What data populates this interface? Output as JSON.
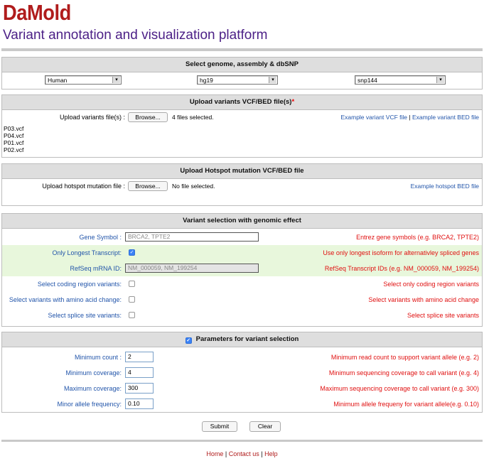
{
  "brand": {
    "logo": "DaMold",
    "subtitle": "Variant annotation and visualization platform"
  },
  "genome_panel": {
    "title": "Select genome, assembly & dbSNP",
    "genome": "Human",
    "assembly": "hg19",
    "dbsnp": "snp144"
  },
  "vcf_panel": {
    "title": "Upload variants VCF/BED file(s)",
    "required_mark": "*",
    "upload_label": "Upload variants file(s) :",
    "browse_label": "Browse...",
    "status": "4 files selected.",
    "example_vcf": "Example variant VCF file",
    "separator": "|",
    "example_bed": "Example variant BED file",
    "files": [
      "P03.vcf",
      "P04.vcf",
      "P01.vcf",
      "P02.vcf"
    ]
  },
  "hotspot_panel": {
    "title": "Upload Hotspot mutation VCF/BED file",
    "upload_label": "Upload hotspot mutation file :",
    "browse_label": "Browse...",
    "status": "No file selected.",
    "example": "Example hotspot BED file"
  },
  "selection_panel": {
    "title": "Variant selection with genomic effect",
    "gene_symbol_label": "Gene Symbol :",
    "gene_symbol_value": "BRCA2, TPTE2",
    "gene_symbol_help": "Entrez gene symbols (e.g. BRCA2, TPTE2)",
    "longest_label": "Only Longest Transcript:",
    "longest_checked": true,
    "longest_help": "Use only longest isoform for alternativley spliced genes",
    "refseq_label": "RefSeq mRNA ID:",
    "refseq_value": "NM_000059, NM_199254",
    "refseq_help": "RefSeq Transcript IDs (e.g. NM_000059, NM_199254)",
    "coding_label": "Select coding region variants:",
    "coding_help": "Select only coding region variants",
    "aa_label": "Select variants with amino acid change:",
    "aa_help": "Select variants with amino acid change",
    "splice_label": "Select splice site variants:",
    "splice_help": "Select splice site variants"
  },
  "params_panel": {
    "title": "Parameters for variant selection",
    "enabled": true,
    "min_count_label": "Minimum count :",
    "min_count_value": "2",
    "min_count_help": "Minimum read count to support variant allele (e.g. 2)",
    "min_cov_label": "Minimum coverage:",
    "min_cov_value": "4",
    "min_cov_help": "Minimum sequencing coverage to call variant (e.g. 4)",
    "max_cov_label": "Maximum coverage:",
    "max_cov_value": "300",
    "max_cov_help": "Maximum sequencing coverage to call variant (e.g. 300)",
    "maf_label": "Minor allele frequency:",
    "maf_value": "0.10",
    "maf_help": "Minimum allele frequeny for variant allele(e.g. 0.10)"
  },
  "actions": {
    "submit": "Submit",
    "clear": "Clear"
  },
  "footer": {
    "home": "Home",
    "contact": "Contact us",
    "help": "Help",
    "sep": "|"
  },
  "colors": {
    "brand_red": "#b01c1c",
    "subtitle_purple": "#4b1f86",
    "link_blue": "#2255aa",
    "help_red": "#e01010",
    "row_green": "#e8f7dc",
    "header_gray": "#dedede"
  }
}
